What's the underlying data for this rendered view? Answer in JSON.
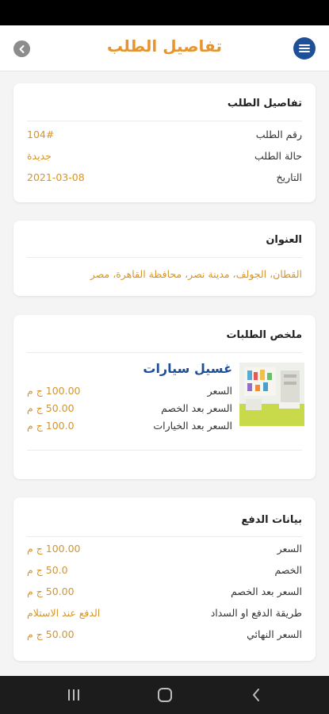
{
  "header": {
    "title": "تفاصيل الطلب"
  },
  "order_details": {
    "title": "تفاصيل الطلب",
    "rows": [
      {
        "label": "رقم الطلب",
        "value": "104#"
      },
      {
        "label": "حالة الطلب",
        "value": "جديدة"
      },
      {
        "label": "التاريخ",
        "value": "2021-03-08"
      }
    ]
  },
  "address": {
    "title": "العنوان",
    "text": "القطان، الجولف، مدينة نصر، محافظة القاهرة، مصر"
  },
  "orders_summary": {
    "title": "ملخص الطلبات",
    "item": {
      "name": "غسيل سيارات",
      "rows": [
        {
          "label": "السعر",
          "value": "100.00 ج م"
        },
        {
          "label": "السعر بعد الخصم",
          "value": "50.00 ج م"
        },
        {
          "label": "السعر بعد الخيارات",
          "value": "100.0 ج م"
        }
      ]
    }
  },
  "payment": {
    "title": "بيانات الدفع",
    "rows": [
      {
        "label": "السعر",
        "value": "100.00 ج م"
      },
      {
        "label": "الخصم",
        "value": "50.0 ج م"
      },
      {
        "label": "السعر بعد الخصم",
        "value": "50.00 ج م"
      },
      {
        "label": "طريقة الدفع او السداد",
        "value": "الدفع عند الاستلام"
      },
      {
        "label": "السعر النهائي",
        "value": "50.00 ج م"
      }
    ]
  },
  "icons": {
    "menu": "menu-icon",
    "back": "back-arrow-icon",
    "nav_recent": "recent-apps-icon",
    "nav_home": "home-icon",
    "nav_back": "nav-back-icon"
  },
  "colors": {
    "accent": "#e6952e",
    "primary": "#1f4f96",
    "value": "#d69526"
  }
}
